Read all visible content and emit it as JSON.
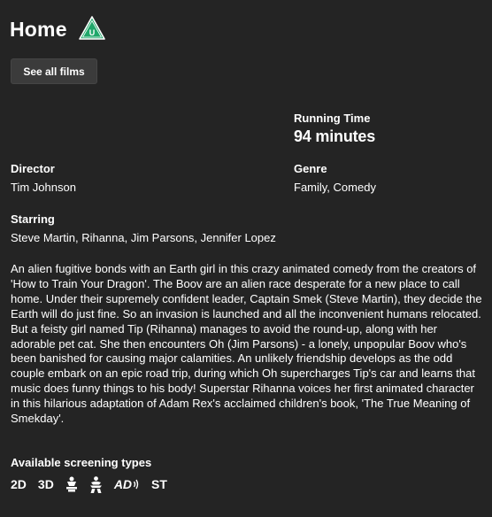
{
  "film": {
    "title": "Home",
    "rating": "U"
  },
  "nav": {
    "see_all_label": "See all films"
  },
  "details": {
    "running_time_label": "Running Time",
    "running_time_value": "94 minutes",
    "director_label": "Director",
    "director_value": "Tim Johnson",
    "genre_label": "Genre",
    "genre_value": "Family, Comedy",
    "starring_label": "Starring",
    "starring_value": "Steve Martin, Rihanna, Jim Parsons, Jennifer Lopez"
  },
  "synopsis": "An alien fugitive bonds with an Earth girl in this crazy animated comedy from the creators of 'How to Train Your Dragon'. The Boov are an alien race desperate for a new place to call home. Under their supremely confident leader, Captain Smek (Steve Martin), they decide the Earth will do just fine. So an invasion is launched and all the inconvenient humans relocated. But a feisty girl named Tip (Rihanna) manages to avoid the round-up, along with her adorable pet cat. She then encounters Oh (Jim Parsons) - a lonely, unpopular Boov who's been banished for causing major calamities. An unlikely friendship develops as the odd couple embark on an epic road trip, during which Oh supercharges Tip's car and learns that music does funny things to his body! Superstar Rihanna voices her first animated character in this hilarious adaptation of Adam Rex's acclaimed children's book, 'The True Meaning of Smekday'.",
  "screening": {
    "label": "Available screening types",
    "types": {
      "2d": "2D",
      "3d": "3D",
      "autism_friendly_icon": "autism-friendly-icon",
      "parent_baby_icon": "parent-baby-icon",
      "audio_description": "AD",
      "subtitled": "ST"
    }
  },
  "colors": {
    "background": "#242424",
    "text": "#ffffff",
    "button_bg": "#3b3b3b",
    "rating_badge": "#1fa76a"
  }
}
